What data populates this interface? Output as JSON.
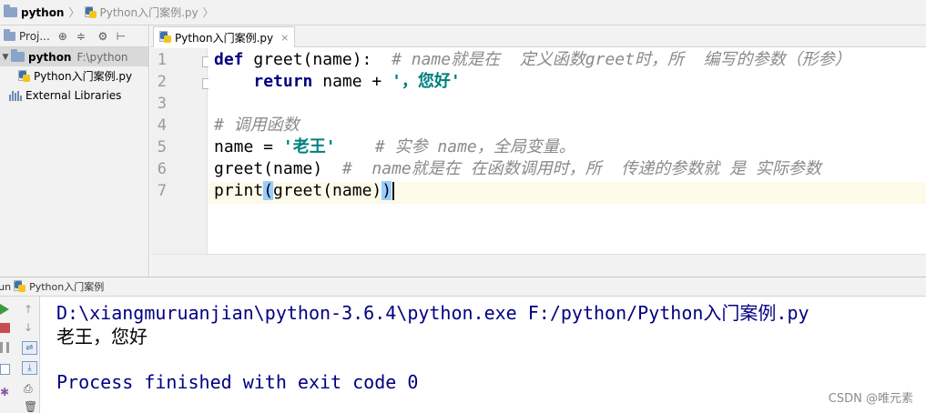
{
  "breadcrumb": {
    "project": "python",
    "file": "Python入门案例.py",
    "chevron": "〉"
  },
  "project_panel": {
    "toolbar_label": "Proj...",
    "tree": [
      {
        "label": "python",
        "path": "F:\\python"
      },
      {
        "label": "Python入门案例.py"
      },
      {
        "label": "External Libraries"
      }
    ]
  },
  "editor": {
    "tab_label": "Python入门案例.py",
    "tab_close": "×",
    "line_numbers": [
      "1",
      "2",
      "3",
      "4",
      "5",
      "6",
      "7"
    ],
    "lines": [
      [
        {
          "t": "def",
          "c": "kw"
        },
        {
          "t": " greet(name):  ",
          "c": ""
        },
        {
          "t": "# name就是在  定义函数greet时，所  编写的参数（形参）",
          "c": "cm"
        }
      ],
      [
        {
          "t": "    ",
          "c": ""
        },
        {
          "t": "return",
          "c": "kw"
        },
        {
          "t": " name + ",
          "c": ""
        },
        {
          "t": "'，您好'",
          "c": "str"
        }
      ],
      [],
      [
        {
          "t": "# 调用函数",
          "c": "cm"
        }
      ],
      [
        {
          "t": "name = ",
          "c": ""
        },
        {
          "t": "'老王'",
          "c": "str"
        },
        {
          "t": "    ",
          "c": ""
        },
        {
          "t": "# 实参 name，全局变量。",
          "c": "cm"
        }
      ],
      [
        {
          "t": "greet(name)  ",
          "c": ""
        },
        {
          "t": "#  name就是在 在函数调用时，所  传递的参数就 是 实际参数",
          "c": "cm"
        }
      ],
      [
        {
          "t": "print",
          "c": ""
        },
        {
          "t": "(",
          "c": "paren"
        },
        {
          "t": "greet(name)",
          "c": ""
        },
        {
          "t": ")",
          "c": "paren"
        }
      ]
    ]
  },
  "run_panel": {
    "label": "Run",
    "config_name": "Python入门案例",
    "console_lines": [
      "D:\\xiangmuruanjian\\python-3.6.4\\python.exe F:/python/Python入门案例.py",
      "老王，您好",
      "",
      "Process finished with exit code 0"
    ]
  },
  "watermark": "CSDN @唯元素",
  "colors": {
    "keyword": "#000080",
    "string": "#008080",
    "comment": "#8a8a8a",
    "console_text": "#000080",
    "paren_highlight": "#99ccff"
  }
}
